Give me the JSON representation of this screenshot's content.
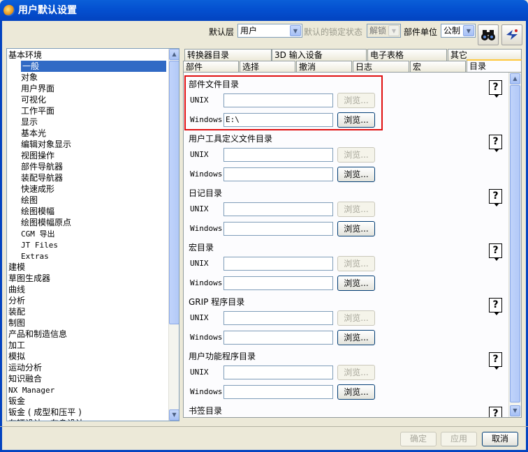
{
  "window": {
    "title": "用户默认设置"
  },
  "toolbar": {
    "level_label": "默认层",
    "level_value": "用户",
    "lock_label": "默认的锁定状态",
    "lock_value": "解锁",
    "unit_label": "部件单位",
    "unit_value": "公制",
    "search_icon": "binoculars-icon",
    "manage_icon": "settings-wand-icon"
  },
  "tree": {
    "items": [
      {
        "label": "基本环境",
        "level": 0
      },
      {
        "label": "一般",
        "level": 1,
        "selected": true
      },
      {
        "label": "对象",
        "level": 1
      },
      {
        "label": "用户界面",
        "level": 1
      },
      {
        "label": "可视化",
        "level": 1
      },
      {
        "label": "工作平面",
        "level": 1
      },
      {
        "label": "显示",
        "level": 1
      },
      {
        "label": "基本光",
        "level": 1
      },
      {
        "label": "编辑对象显示",
        "level": 1
      },
      {
        "label": "视图操作",
        "level": 1
      },
      {
        "label": "部件导航器",
        "level": 1
      },
      {
        "label": "装配导航器",
        "level": 1
      },
      {
        "label": "快速成形",
        "level": 1
      },
      {
        "label": "绘图",
        "level": 1
      },
      {
        "label": "绘图模幅",
        "level": 1
      },
      {
        "label": "绘图模幅原点",
        "level": 1
      },
      {
        "label": "CGM 导出",
        "level": 1
      },
      {
        "label": "JT Files",
        "level": 1
      },
      {
        "label": "Extras",
        "level": 1
      },
      {
        "label": "建模",
        "level": 0
      },
      {
        "label": "草图生成器",
        "level": 0
      },
      {
        "label": "曲线",
        "level": 0
      },
      {
        "label": "分析",
        "level": 0
      },
      {
        "label": "装配",
        "level": 0
      },
      {
        "label": "制图",
        "level": 0
      },
      {
        "label": "产品和制造信息",
        "level": 0
      },
      {
        "label": "加工",
        "level": 0
      },
      {
        "label": "模拟",
        "level": 0
      },
      {
        "label": "运动分析",
        "level": 0
      },
      {
        "label": "知识融合",
        "level": 0
      },
      {
        "label": "NX Manager",
        "level": 0
      },
      {
        "label": "钣金",
        "level": 0
      },
      {
        "label": "钣金 ( 成型和压平 )",
        "level": 0
      },
      {
        "label": "车辆设计 - 车身设计",
        "level": 0
      }
    ]
  },
  "tabs": {
    "row1": [
      "转换器目录",
      "3D 输入设备",
      "电子表格",
      "其它"
    ],
    "row2": [
      "部件",
      "选择",
      "撤消",
      "日志",
      "宏",
      "目录"
    ],
    "active": "目录"
  },
  "sections": [
    {
      "title": "部件文件目录",
      "unix_label": "UNIX",
      "unix_value": "",
      "windows_label": "Windows",
      "windows_value": "E:\\",
      "browse_label": "浏览..."
    },
    {
      "title": "用户工具定义文件目录",
      "unix_label": "UNIX",
      "unix_value": "",
      "windows_label": "Windows",
      "windows_value": "",
      "browse_label": "浏览..."
    },
    {
      "title": "日记目录",
      "unix_label": "UNIX",
      "unix_value": "",
      "windows_label": "Windows",
      "windows_value": "",
      "browse_label": "浏览..."
    },
    {
      "title": "宏目录",
      "unix_label": "UNIX",
      "unix_value": "",
      "windows_label": "Windows",
      "windows_value": "",
      "browse_label": "浏览..."
    },
    {
      "title": "GRIP 程序目录",
      "unix_label": "UNIX",
      "unix_value": "",
      "windows_label": "Windows",
      "windows_value": "",
      "browse_label": "浏览..."
    },
    {
      "title": "用户功能程序目录",
      "unix_label": "UNIX",
      "unix_value": "",
      "windows_label": "Windows",
      "windows_value": "",
      "browse_label": "浏览..."
    },
    {
      "title": "书签目录"
    }
  ],
  "help_glyph": "?",
  "footer": {
    "ok": "确定",
    "apply": "应用",
    "cancel": "取消"
  }
}
